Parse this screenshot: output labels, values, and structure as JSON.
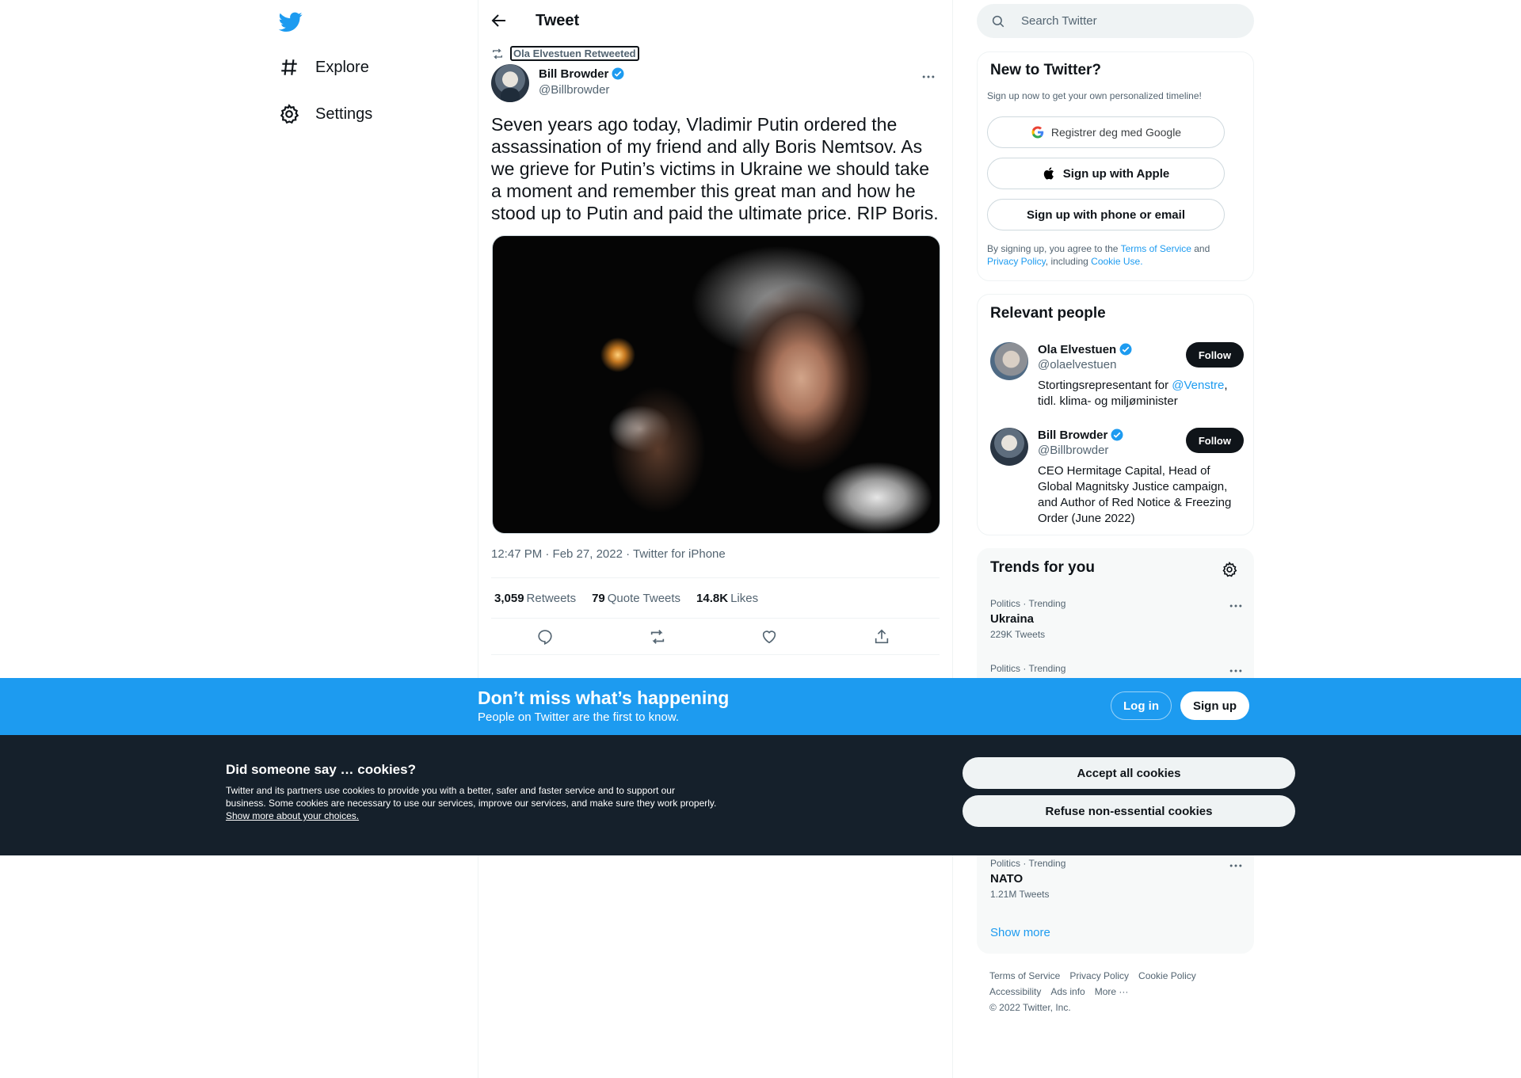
{
  "nav": {
    "logo_icon": "twitter-bird-icon",
    "items": [
      {
        "label": "Explore",
        "icon": "hashtag-icon"
      },
      {
        "label": "Settings",
        "icon": "gear-icon"
      }
    ]
  },
  "header": {
    "title": "Tweet"
  },
  "tweet": {
    "retweeted_by": "Ola Elvestuen Retweeted",
    "author_name": "Bill Browder",
    "author_handle": "@Billbrowder",
    "text": "Seven years ago today, Vladimir Putin ordered the assassination of my friend and ally Boris Nemtsov. As we grieve for Putin’s victims in Ukraine we should take a moment and remember this great man and how he stood up to Putin and paid the ultimate price. RIP Boris.",
    "meta": "12:47 PM · Feb 27, 2022 · Twitter for iPhone",
    "stats": {
      "retweets_count": "3,059",
      "retweets_label": "Retweets",
      "quotes_count": "79",
      "quotes_label": "Quote Tweets",
      "likes_count": "14.8K",
      "likes_label": "Likes"
    }
  },
  "search": {
    "placeholder": "Search Twitter"
  },
  "new_to_twitter": {
    "title": "New to Twitter?",
    "subtitle": "Sign up now to get your own personalized timeline!",
    "google_label": "Registrer deg med Google",
    "apple_label": "Sign up with Apple",
    "phone_label": "Sign up with phone or email",
    "legal_1": "By signing up, you agree to the ",
    "terms": "Terms of Service",
    "legal_2": " and ",
    "privacy": "Privacy Policy",
    "legal_3": ", including ",
    "cookie_use": "Cookie Use."
  },
  "relevant_people": {
    "title": "Relevant people",
    "follow_label": "Follow",
    "people": [
      {
        "name": "Ola Elvestuen",
        "handle": "@olaelvestuen",
        "bio_1": "Stortingsrepresentant for ",
        "bio_link": "@Venstre",
        "bio_2": ", tidl. klima- og miljøminister"
      },
      {
        "name": "Bill Browder",
        "handle": "@Billbrowder",
        "bio": "CEO Hermitage Capital, Head of Global Magnitsky Justice campaign, and Author of Red Notice & Freezing Order (June 2022)"
      }
    ]
  },
  "trends": {
    "title": "Trends for you",
    "items": [
      {
        "category": "Politics · Trending",
        "name": "Ukraina",
        "count": "229K Tweets"
      },
      {
        "category": "Politics · Trending",
        "name": "",
        "count": ""
      },
      {
        "category": "Politics · Trending",
        "name": "NATO",
        "count": "1.21M Tweets"
      }
    ],
    "show_more": "Show more"
  },
  "footer": {
    "links": [
      "Terms of Service",
      "Privacy Policy",
      "Cookie Policy",
      "Accessibility",
      "Ads info",
      "More ···"
    ],
    "copyright": "© 2022 Twitter, Inc."
  },
  "banner": {
    "title": "Don’t miss what’s happening",
    "subtitle": "People on Twitter are the first to know.",
    "login": "Log in",
    "signup": "Sign up"
  },
  "cookie": {
    "title": "Did someone say … cookies?",
    "text": "Twitter and its partners use cookies to provide you with a better, safer and faster service and to support our business. Some cookies are necessary to use our services, improve our services, and make sure they work properly. ",
    "link": "Show more about your choices.",
    "accept": "Accept all cookies",
    "refuse": "Refuse non-essential cookies"
  },
  "colors": {
    "accent": "#1d9bf0",
    "text": "#0f1419",
    "muted": "#536471",
    "cookie_bg": "#15202b"
  }
}
